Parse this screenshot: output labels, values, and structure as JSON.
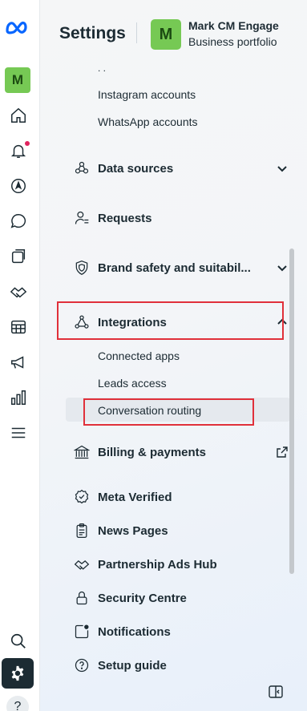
{
  "header": {
    "title": "Settings",
    "avatar_letter": "M",
    "business_name": "Mark CM Engage",
    "business_subtitle": "Business portfolio"
  },
  "rail": {
    "avatar_letter": "M",
    "items": [
      "meta-logo",
      "home",
      "notifications",
      "explore",
      "messages",
      "pages",
      "partnerships",
      "table",
      "ads",
      "insights",
      "menu",
      "search",
      "settings",
      "help"
    ],
    "help_label": "?"
  },
  "nav": {
    "truncated_top": ". .",
    "accounts_subitems": [
      "Instagram accounts",
      "WhatsApp accounts"
    ],
    "data_sources": "Data sources",
    "requests": "Requests",
    "brand_safety": "Brand safety and suitabil...",
    "integrations": "Integrations",
    "integrations_subitems": [
      "Connected apps",
      "Leads access",
      "Conversation routing"
    ],
    "billing": "Billing & payments",
    "meta_verified": "Meta Verified",
    "news_pages": "News Pages",
    "partnership_ads": "Partnership Ads Hub",
    "security": "Security Centre",
    "notifications": "Notifications",
    "setup_guide": "Setup guide"
  },
  "colors": {
    "accent_green": "#76c954",
    "highlight_red": "#e0303a",
    "dark": "#1c2b33"
  }
}
